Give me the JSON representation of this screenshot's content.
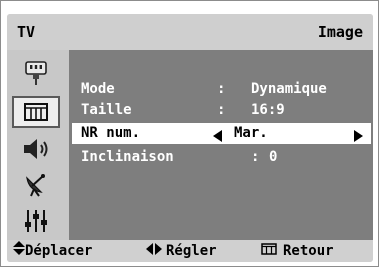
{
  "header": {
    "tab": "TV",
    "title": "Image"
  },
  "sidebar": {
    "items": [
      {
        "icon": "antenna-plug-icon",
        "active": false
      },
      {
        "icon": "picture-icon",
        "active": true
      },
      {
        "icon": "speaker-icon",
        "active": false
      },
      {
        "icon": "satellite-dish-icon",
        "active": false
      },
      {
        "icon": "sliders-icon",
        "active": false
      }
    ]
  },
  "menu": {
    "rows": [
      {
        "label": "Mode",
        "colon": ":",
        "value": "Dynamique"
      },
      {
        "label": "Taille",
        "colon": ":",
        "value": "16:9"
      },
      {
        "label": "NR num.",
        "value": "Mar.",
        "selected": true
      },
      {
        "label": "Inclinaison",
        "colon": ":",
        "value": "0"
      }
    ]
  },
  "footer": {
    "move": "Déplacer",
    "adjust": "Régler",
    "back": "Retour"
  },
  "colors": {
    "panel": "#d2d2d2",
    "content": "#7e7e7e",
    "highlight": "#ffffff"
  }
}
